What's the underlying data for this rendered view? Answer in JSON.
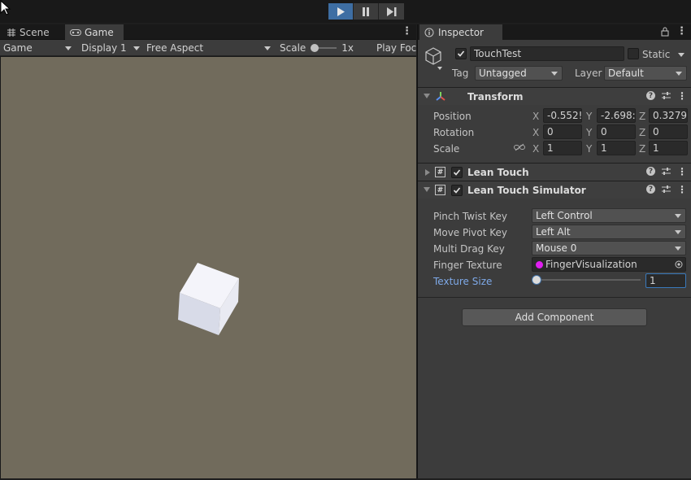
{
  "toolbar": {
    "play_icon": "play-icon",
    "pause_icon": "pause-icon",
    "step_icon": "step-icon",
    "colors": {
      "play_active": "#3e6ea3"
    }
  },
  "left_tabs": [
    {
      "label": "Scene",
      "icon": "scene-grid-icon"
    },
    {
      "label": "Game",
      "icon": "gamepad-icon"
    }
  ],
  "game_toolbar": {
    "display_mode": "Game",
    "display": "Display 1",
    "aspect": "Free Aspect",
    "scale_label": "Scale",
    "scale_value": "1x",
    "play_focus": "Play Foc"
  },
  "viewport": {
    "background": "#716b5c"
  },
  "inspector": {
    "tab_label": "Inspector",
    "object_name": "TouchTest",
    "static_label": "Static",
    "tag_label": "Tag",
    "tag_value": "Untagged",
    "layer_label": "Layer",
    "layer_value": "Default",
    "transform": {
      "title": "Transform",
      "position_label": "Position",
      "rotation_label": "Rotation",
      "scale_label": "Scale",
      "position": {
        "x": "-0.552!",
        "y": "-2.698:",
        "z": "0.3279"
      },
      "rotation": {
        "x": "0",
        "y": "0",
        "z": "0"
      },
      "scale": {
        "x": "1",
        "y": "1",
        "z": "1"
      }
    },
    "lean_touch": {
      "title": "Lean Touch"
    },
    "lean_touch_sim": {
      "title": "Lean Touch Simulator",
      "pinch_label": "Pinch Twist Key",
      "pinch_value": "Left Control",
      "pivot_label": "Move Pivot Key",
      "pivot_value": "Left Alt",
      "multi_label": "Multi Drag Key",
      "multi_value": "Mouse 0",
      "texture_label": "Finger Texture",
      "texture_value": "FingerVisualization",
      "size_label": "Texture Size",
      "size_value": "1",
      "size_slider_fraction": 0
    },
    "add_component": "Add Component"
  }
}
